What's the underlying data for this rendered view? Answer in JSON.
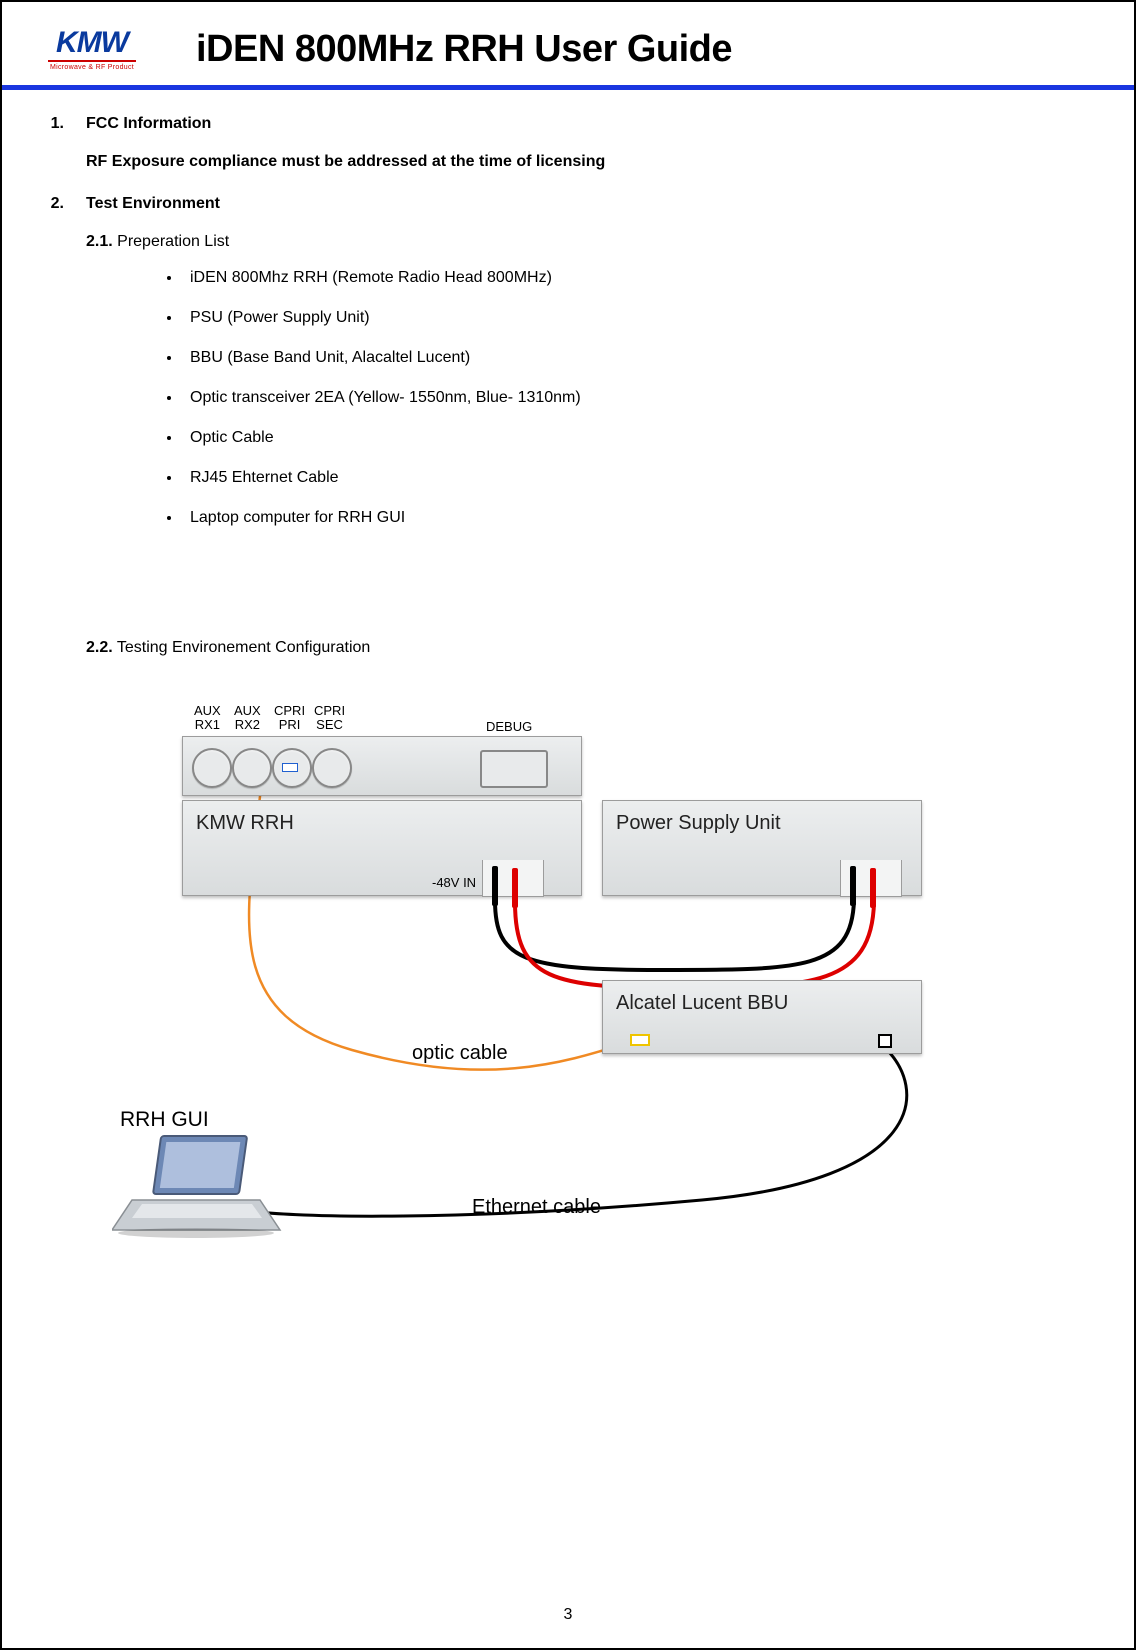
{
  "logo": {
    "text": "KMW",
    "sub": "Microwave & RF Product"
  },
  "title": "iDEN 800MHz RRH User Guide",
  "sections": {
    "s1": {
      "num": "1.",
      "title": "FCC Information",
      "body": "RF Exposure compliance must be addressed at the time of licensing"
    },
    "s2": {
      "num": "2.",
      "title": "Test Environment"
    }
  },
  "subsections": {
    "s21": {
      "num": "2.1.",
      "title": "Preperation List"
    },
    "s22": {
      "num": "2.2.",
      "title": "Testing Environement Configuration"
    }
  },
  "prep_items": [
    "iDEN 800Mhz RRH (Remote Radio Head 800MHz)",
    "PSU (Power Supply Unit)",
    "BBU (Base Band Unit, Alacaltel Lucent)",
    "Optic transceiver 2EA (Yellow- 1550nm, Blue- 1310nm)",
    "Optic Cable",
    "RJ45 Ehternet Cable",
    "Laptop computer for RRH GUI"
  ],
  "diagram": {
    "port_labels": {
      "aux_rx1": "AUX\nRX1",
      "aux_rx2": "AUX\nRX2",
      "cpri_pri": "CPRI\nPRI",
      "cpri_sec": "CPRI\nSEC",
      "debug": "DEBUG",
      "v48": "-48V IN"
    },
    "unit_labels": {
      "rrh": "KMW RRH",
      "psu": "Power Supply Unit",
      "bbu": "Alcatel Lucent BBU"
    },
    "cable_labels": {
      "optic": "optic cable",
      "eth": "Ethernet cable",
      "gui": "RRH GUI"
    }
  },
  "page_number": "3"
}
